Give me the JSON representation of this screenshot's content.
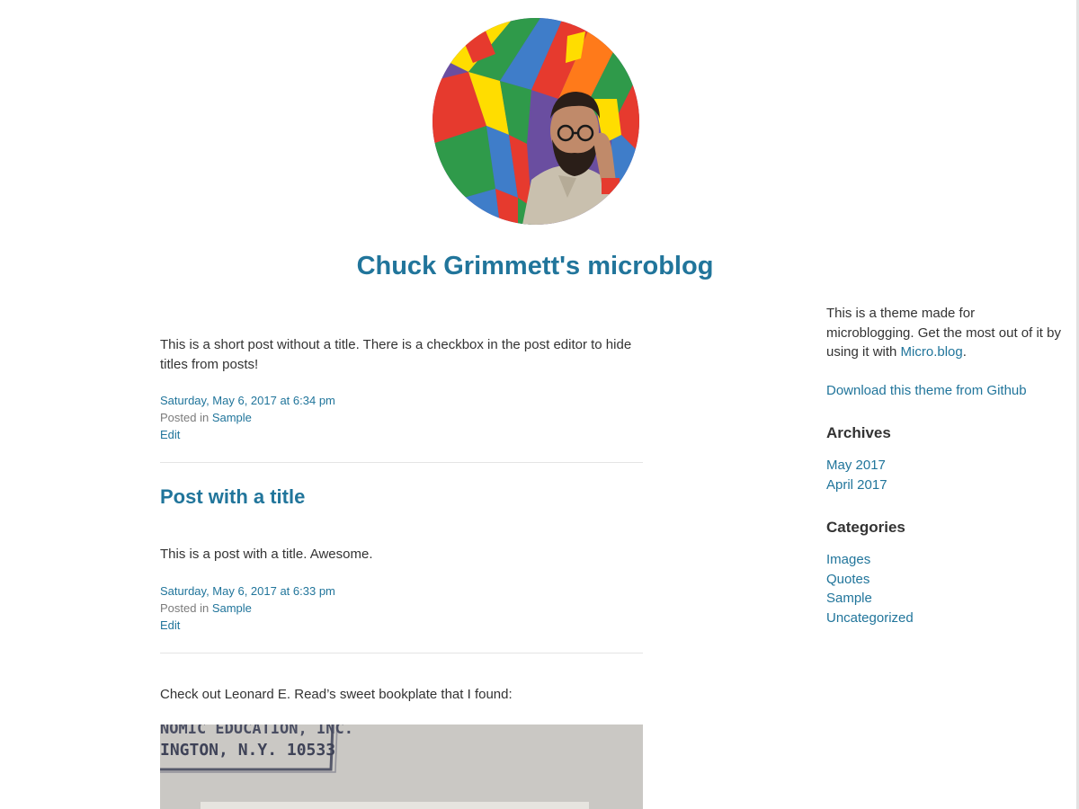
{
  "site": {
    "title": "Chuck Grimmett's microblog"
  },
  "posts": [
    {
      "title": "",
      "body": "This is a short post without a title. There is a checkbox in the post editor to hide titles from posts!",
      "date": "Saturday, May 6, 2017 at 6:34 pm",
      "posted_in_label": "Posted in",
      "category": "Sample",
      "edit_label": "Edit"
    },
    {
      "title": "Post with a title",
      "body": "This is a post with a title. Awesome.",
      "date": "Saturday, May 6, 2017 at 6:33 pm",
      "posted_in_label": "Posted in",
      "category": "Sample",
      "edit_label": "Edit"
    },
    {
      "body": "Check out Leonard E. Read’s sweet bookplate that I found:",
      "image_text": {
        "line1": "NOMIC EDUCATION, INC.",
        "line2": "INGTON, N.Y. 10533"
      }
    }
  ],
  "sidebar": {
    "about_text": "This is a theme made for microblogging. Get the most out of it by using it with",
    "about_link": "Micro.blog",
    "about_suffix": ".",
    "download_link": "Download this theme from Github",
    "archives_heading": "Archives",
    "archives": [
      "May 2017",
      "April 2017"
    ],
    "categories_heading": "Categories",
    "categories": [
      "Images",
      "Quotes",
      "Sample",
      "Uncategorized"
    ]
  },
  "colors": {
    "link": "#21759b",
    "text": "#333333",
    "muted": "#7b7b7b"
  }
}
